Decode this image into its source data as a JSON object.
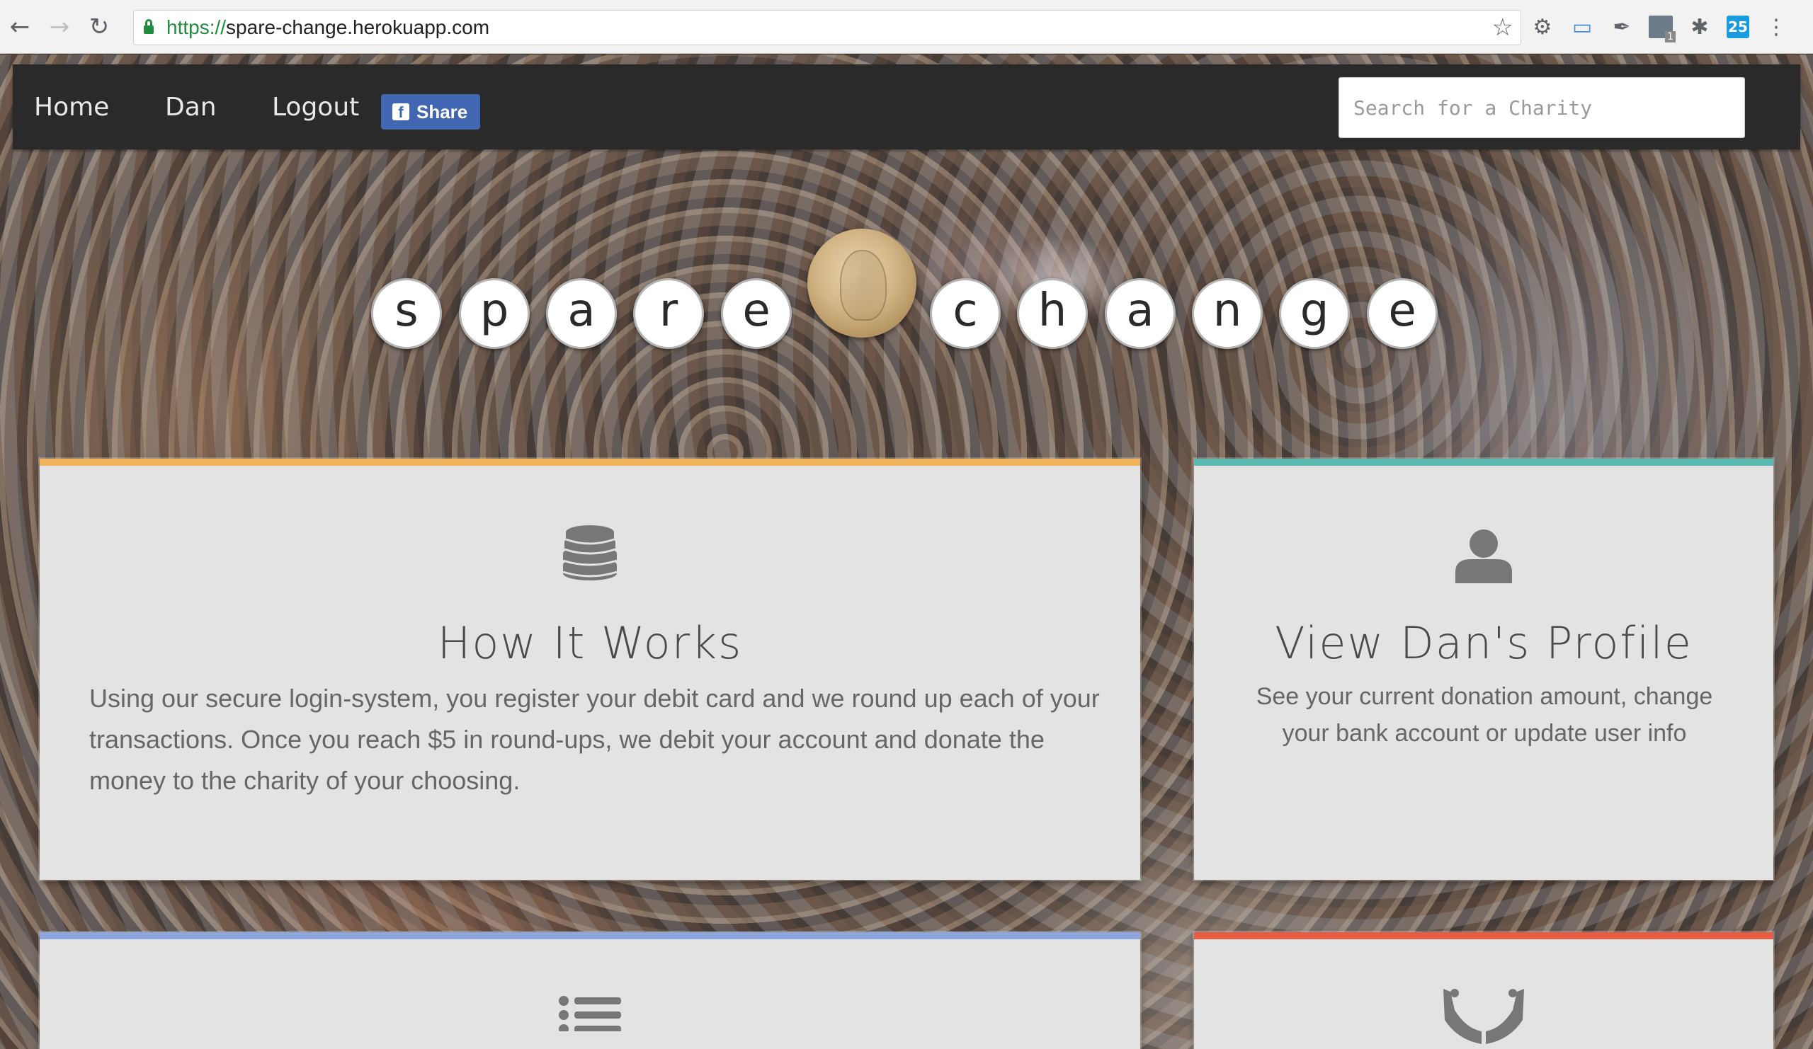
{
  "browser": {
    "url_scheme": "https://",
    "url_host": "spare-change.herokuapp.com"
  },
  "nav": {
    "home": "Home",
    "user": "Dan",
    "logout": "Logout",
    "share": "Share",
    "search_placeholder": "Search for a Charity"
  },
  "logo": {
    "letters_left": [
      "s",
      "p",
      "a",
      "r",
      "e"
    ],
    "letters_right": [
      "c",
      "h",
      "a",
      "n",
      "g",
      "e"
    ]
  },
  "cards": {
    "how": {
      "title": "How It Works",
      "text": "Using our secure login-system, you register your debit card and we round up each of your transactions. Once you reach $5 in round-ups, we debit your account and donate the money to the charity of your choosing.",
      "icon": "coins-icon",
      "accent": "#f0b35a"
    },
    "profile": {
      "title": "View Dan's Profile",
      "text": "See your current donation amount, change your bank account or update user info",
      "icon": "user-icon",
      "accent": "#5ab9ae"
    },
    "list": {
      "icon": "list-icon",
      "accent": "#8ea6e0"
    },
    "give": {
      "icon": "hands-icon",
      "accent": "#e85c44"
    }
  }
}
